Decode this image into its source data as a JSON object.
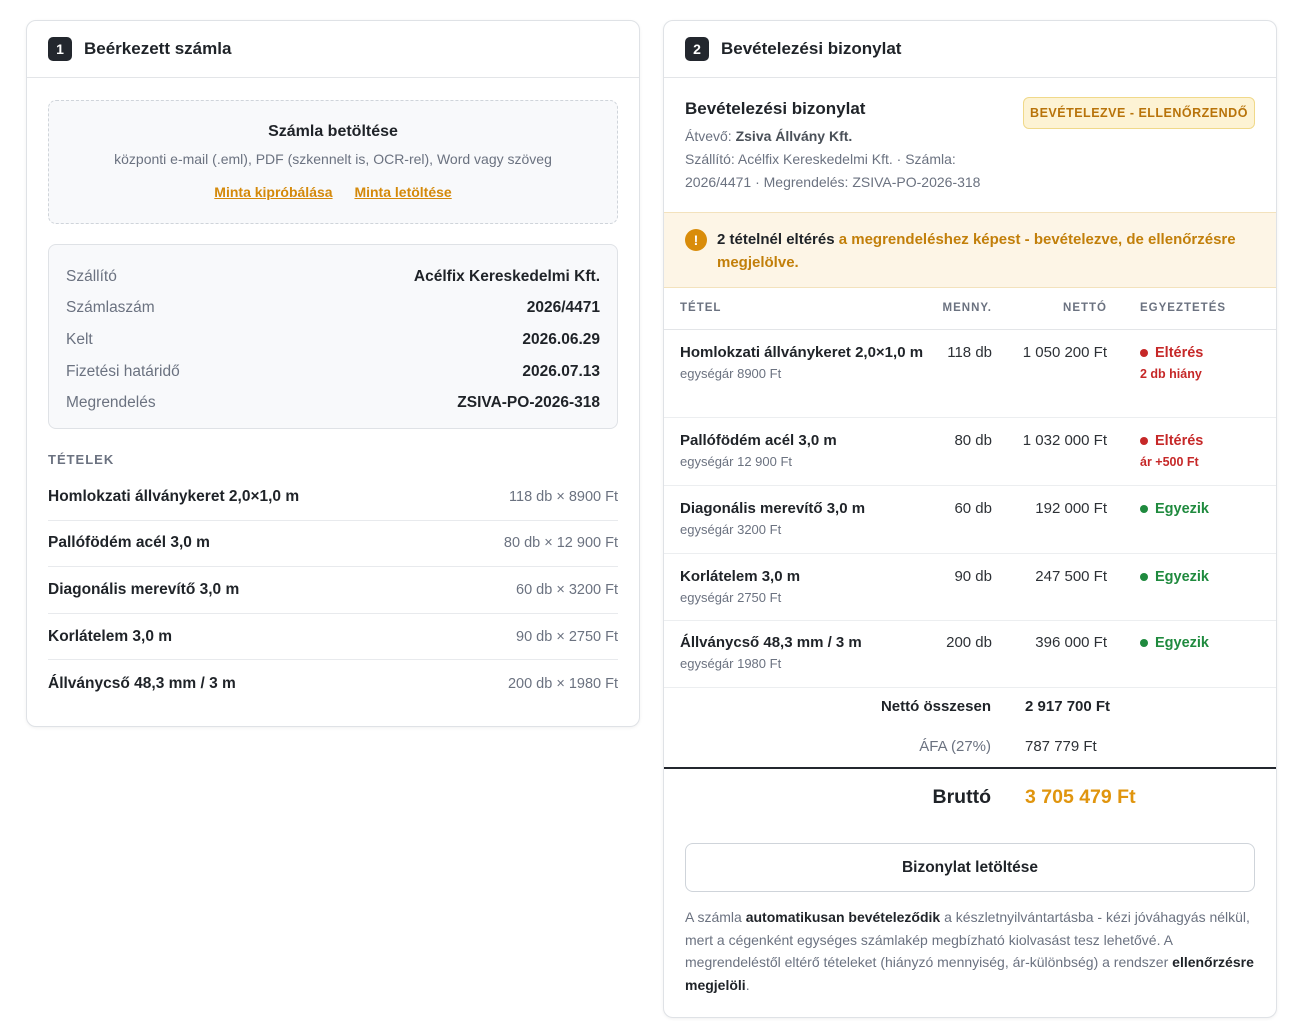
{
  "left": {
    "step": "1",
    "title": "Beérkezett számla",
    "upload": {
      "title": "Számla betöltése",
      "subtitle": "központi e-mail (.eml), PDF (szkennelt is, OCR-rel), Word vagy szöveg",
      "try_sample": "Minta kipróbálása",
      "download_sample": "Minta letöltése"
    },
    "details": [
      {
        "label": "Szállító",
        "value": "Acélfix Kereskedelmi Kft."
      },
      {
        "label": "Számlaszám",
        "value": "2026/4471"
      },
      {
        "label": "Kelt",
        "value": "2026.06.29"
      },
      {
        "label": "Fizetési határidő",
        "value": "2026.07.13"
      },
      {
        "label": "Megrendelés",
        "value": "ZSIVA-PO-2026-318"
      }
    ],
    "items_label": "TÉTELEK",
    "items": [
      {
        "name": "Homlokzati állványkeret 2,0×1,0 m",
        "qty": "118 db × 8900 Ft"
      },
      {
        "name": "Pallófödém acél 3,0 m",
        "qty": "80 db × 12 900 Ft"
      },
      {
        "name": "Diagonális merevítő 3,0 m",
        "qty": "60 db × 3200 Ft"
      },
      {
        "name": "Korlátelem 3,0 m",
        "qty": "90 db × 2750 Ft"
      },
      {
        "name": "Állványcső 48,3 mm / 3 m",
        "qty": "200 db × 1980 Ft"
      }
    ]
  },
  "right": {
    "step": "2",
    "title": "Bevételezési bizonylat",
    "doc_title": "Bevételezési bizonylat",
    "receiver_label": "Átvevő:",
    "receiver": "Zsiva Állvány Kft.",
    "meta_line": "Szállító: Acélfix Kereskedelmi Kft. · Számla: 2026/4471 · Megrendelés: ZSIVA-PO-2026-318",
    "badge": "BEVÉTELEZVE - ELLENŐRZENDŐ",
    "alert_icon": "!",
    "alert_strong": "2 tételnél eltérés",
    "alert_rest": "a megrendeléshez képest - bevételezve, de ellenőrzésre megjelölve.",
    "columns": {
      "item": "TÉTEL",
      "qty": "MENNY.",
      "net": "NETTÓ",
      "match": "EGYEZTETÉS"
    },
    "rows": [
      {
        "name": "Homlokzati állványkeret 2,0×1,0 m",
        "unit": "egységár 8900 Ft",
        "qty": "118 db",
        "net": "1 050 200 Ft",
        "status": "Eltérés",
        "note": "2 db hiány"
      },
      {
        "name": "Pallófödém acél 3,0 m",
        "unit": "egységár 12 900 Ft",
        "qty": "80 db",
        "net": "1 032 000 Ft",
        "status": "Eltérés",
        "note": "ár +500 Ft"
      },
      {
        "name": "Diagonális merevítő 3,0 m",
        "unit": "egységár 3200 Ft",
        "qty": "60 db",
        "net": "192 000 Ft",
        "status": "Egyezik",
        "note": ""
      },
      {
        "name": "Korlátelem 3,0 m",
        "unit": "egységár 2750 Ft",
        "qty": "90 db",
        "net": "247 500 Ft",
        "status": "Egyezik",
        "note": ""
      },
      {
        "name": "Állványcső 48,3 mm / 3 m",
        "unit": "egységár 1980 Ft",
        "qty": "200 db",
        "net": "396 000 Ft",
        "status": "Egyezik",
        "note": ""
      }
    ],
    "net_total_label": "Nettó összesen",
    "net_total": "2 917 700 Ft",
    "vat_label": "ÁFA (27%)",
    "vat": "787 779 Ft",
    "gross_label": "Bruttó",
    "gross": "3 705 479 Ft",
    "download_button": "Bizonylat letöltése",
    "footer": {
      "p1": "A számla ",
      "b1": "automatikusan bevételeződik",
      "p2": " a készletnyilvántartásba - kézi jóváhagyás nélkül, mert a cégenként egységes számlakép megbízható kiolvasást tesz lehetővé. A megrendeléstől eltérő tételeket (hiányzó mennyiség, ár-különbség) a rendszer ",
      "b2": "ellenőrzésre megjelöli",
      "p3": "."
    }
  },
  "colors": {
    "accent": "#d4890a",
    "mismatch": "#c62828",
    "match": "#1f8a3e",
    "gross": "#e0950e"
  }
}
